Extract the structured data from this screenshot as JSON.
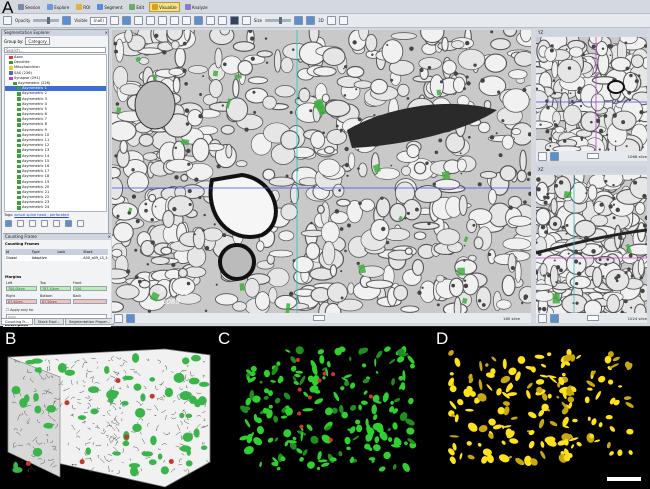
{
  "labels": {
    "a": "A",
    "b": "B",
    "c": "C",
    "d": "D"
  },
  "menu": [
    {
      "label": "Session",
      "color": "#7a8aa8"
    },
    {
      "label": "Explore",
      "color": "#6a9ad8"
    },
    {
      "label": "ROI",
      "color": "#e0b040"
    },
    {
      "label": "Segment",
      "color": "#5a8ad8"
    },
    {
      "label": "Edit",
      "color": "#6aaa6a"
    },
    {
      "label": "Visualize",
      "color": "#d8a020"
    },
    {
      "label": "Analyze",
      "color": "#8a7ac8"
    }
  ],
  "toolbar": {
    "opacity_label": "Opacity",
    "visible_label": "Visible",
    "visible_value": "(null)",
    "size_label": "Size",
    "mode_3d": "3D"
  },
  "explorer": {
    "title": "Segmentation Explorer",
    "group_by_label": "Group by:",
    "group_by_value": "Category",
    "search_placeholder": "Search...",
    "tree": [
      {
        "label": "Axon",
        "color": "#e03a3a",
        "indent": 1
      },
      {
        "label": "Dendrite",
        "color": "#3a9a3a",
        "indent": 1
      },
      {
        "label": "Mitochondrion",
        "color": "#e0d020",
        "indent": 1
      },
      {
        "label": "SAS (236)",
        "color": "#4a6ad8",
        "indent": 1
      },
      {
        "label": "Synapse (291)",
        "color": "#c83ac8",
        "indent": 1
      },
      {
        "label": "Asymmetric (226)",
        "color": "#3aa03a",
        "indent": 2
      },
      {
        "label": "Asymmetric 1",
        "color": "#3aa03a",
        "indent": 3,
        "selected": true
      },
      {
        "label": "Asymmetric 2",
        "color": "#3aa03a",
        "indent": 3
      },
      {
        "label": "Asymmetric 3",
        "color": "#3aa03a",
        "indent": 3
      },
      {
        "label": "Asymmetric 4",
        "color": "#3aa03a",
        "indent": 3
      },
      {
        "label": "Asymmetric 5",
        "color": "#3aa03a",
        "indent": 3
      },
      {
        "label": "Asymmetric 6",
        "color": "#3aa03a",
        "indent": 3
      },
      {
        "label": "Asymmetric 7",
        "color": "#3aa03a",
        "indent": 3
      },
      {
        "label": "Asymmetric 8",
        "color": "#3aa03a",
        "indent": 3
      },
      {
        "label": "Asymmetric 9",
        "color": "#3aa03a",
        "indent": 3
      },
      {
        "label": "Asymmetric 10",
        "color": "#3aa03a",
        "indent": 3
      },
      {
        "label": "Asymmetric 11",
        "color": "#3aa03a",
        "indent": 3
      },
      {
        "label": "Asymmetric 12",
        "color": "#3aa03a",
        "indent": 3
      },
      {
        "label": "Asymmetric 13",
        "color": "#3aa03a",
        "indent": 3
      },
      {
        "label": "Asymmetric 14",
        "color": "#3aa03a",
        "indent": 3
      },
      {
        "label": "Asymmetric 15",
        "color": "#3aa03a",
        "indent": 3
      },
      {
        "label": "Asymmetric 16",
        "color": "#3aa03a",
        "indent": 3
      },
      {
        "label": "Asymmetric 17",
        "color": "#3aa03a",
        "indent": 3
      },
      {
        "label": "Asymmetric 18",
        "color": "#3aa03a",
        "indent": 3
      },
      {
        "label": "Asymmetric 19",
        "color": "#3aa03a",
        "indent": 3
      },
      {
        "label": "Asymmetric 20",
        "color": "#3aa03a",
        "indent": 3
      },
      {
        "label": "Asymmetric 21",
        "color": "#3aa03a",
        "indent": 3
      },
      {
        "label": "Asymmetric 22",
        "color": "#3aa03a",
        "indent": 3
      },
      {
        "label": "Asymmetric 23",
        "color": "#3aa03a",
        "indent": 3
      },
      {
        "label": "Asymmetric 24",
        "color": "#3aa03a",
        "indent": 3
      }
    ],
    "tags_label": "Tags:",
    "tags_value": "actual spine head , perforated"
  },
  "counting": {
    "title": "Counting Frame",
    "frames_label": "Counting Frames",
    "headers": [
      "Id",
      "Type",
      "Lock",
      "Stack"
    ],
    "row": [
      "Global",
      "Adaptive",
      "",
      "A00_a09_L3_10_GRZ.tif"
    ],
    "margins_label": "Margins",
    "left_label": "Left",
    "top_label": "Top",
    "front_label": "Front",
    "left_value": "700,00nm",
    "top_value": "787,50nm",
    "front_value": "150",
    "right_label": "Right",
    "bottom_label": "Bottom",
    "back_label": "Back",
    "right_value": "87,50nm",
    "bottom_value": "87,50nm",
    "back_value": "",
    "apply_only_label": "Apply only for",
    "apply_only_value": "Axon",
    "description_label": "Description"
  },
  "bottom_tabs": [
    "Counting Fr...",
    "Stack Expl...",
    "Segmentation Proper..."
  ],
  "views": {
    "main_footer": "160 slice",
    "side1_header": "YZ",
    "side1_footer": "1068 slice",
    "side2_header": "XZ",
    "side2_footer": "1024 slice",
    "main_scale_labels": [
      "9",
      "709",
      "1069"
    ]
  }
}
